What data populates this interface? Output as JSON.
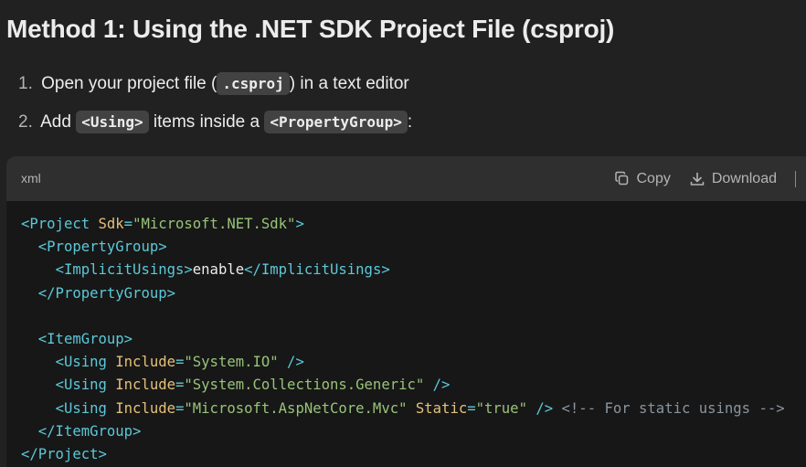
{
  "heading": "Method 1: Using the .NET SDK Project File (csproj)",
  "steps": [
    {
      "num": "1.",
      "before": "Open your project file (",
      "code": ".csproj",
      "after": ") in a text editor"
    },
    {
      "num": "2.",
      "before": "Add ",
      "code": "<Using>",
      "middle": " items inside a ",
      "code2": "<PropertyGroup>",
      "after": ":"
    }
  ],
  "code_block": {
    "language": "xml",
    "copy_label": "Copy",
    "download_label": "Download",
    "icons": [
      "copy-icon",
      "download-icon",
      "run-icon"
    ],
    "lines": [
      [
        {
          "t": "tag",
          "v": "<Project "
        },
        {
          "t": "attr",
          "v": "Sdk"
        },
        {
          "t": "tag",
          "v": "="
        },
        {
          "t": "str",
          "v": "\"Microsoft.NET.Sdk\""
        },
        {
          "t": "tag",
          "v": ">"
        }
      ],
      [
        {
          "t": "txt",
          "v": "  "
        },
        {
          "t": "tag",
          "v": "<PropertyGroup>"
        }
      ],
      [
        {
          "t": "txt",
          "v": "    "
        },
        {
          "t": "tag",
          "v": "<ImplicitUsings>"
        },
        {
          "t": "txt",
          "v": "enable"
        },
        {
          "t": "tag",
          "v": "</ImplicitUsings>"
        }
      ],
      [
        {
          "t": "txt",
          "v": "  "
        },
        {
          "t": "tag",
          "v": "</PropertyGroup>"
        }
      ],
      [
        {
          "t": "txt",
          "v": " "
        }
      ],
      [
        {
          "t": "txt",
          "v": "  "
        },
        {
          "t": "tag",
          "v": "<ItemGroup>"
        }
      ],
      [
        {
          "t": "txt",
          "v": "    "
        },
        {
          "t": "tag",
          "v": "<Using "
        },
        {
          "t": "attr",
          "v": "Include"
        },
        {
          "t": "tag",
          "v": "="
        },
        {
          "t": "str",
          "v": "\"System.IO\""
        },
        {
          "t": "tag",
          "v": " />"
        }
      ],
      [
        {
          "t": "txt",
          "v": "    "
        },
        {
          "t": "tag",
          "v": "<Using "
        },
        {
          "t": "attr",
          "v": "Include"
        },
        {
          "t": "tag",
          "v": "="
        },
        {
          "t": "str",
          "v": "\"System.Collections.Generic\""
        },
        {
          "t": "tag",
          "v": " />"
        }
      ],
      [
        {
          "t": "txt",
          "v": "    "
        },
        {
          "t": "tag",
          "v": "<Using "
        },
        {
          "t": "attr",
          "v": "Include"
        },
        {
          "t": "tag",
          "v": "="
        },
        {
          "t": "str",
          "v": "\"Microsoft.AspNetCore.Mvc\""
        },
        {
          "t": "txt",
          "v": " "
        },
        {
          "t": "attr",
          "v": "Static"
        },
        {
          "t": "tag",
          "v": "="
        },
        {
          "t": "str",
          "v": "\"true\""
        },
        {
          "t": "tag",
          "v": " />"
        },
        {
          "t": "txt",
          "v": " "
        },
        {
          "t": "cmt",
          "v": "<!-- For static usings -->"
        }
      ],
      [
        {
          "t": "txt",
          "v": "  "
        },
        {
          "t": "tag",
          "v": "</ItemGroup>"
        }
      ],
      [
        {
          "t": "tag",
          "v": "</Project>"
        }
      ]
    ]
  }
}
